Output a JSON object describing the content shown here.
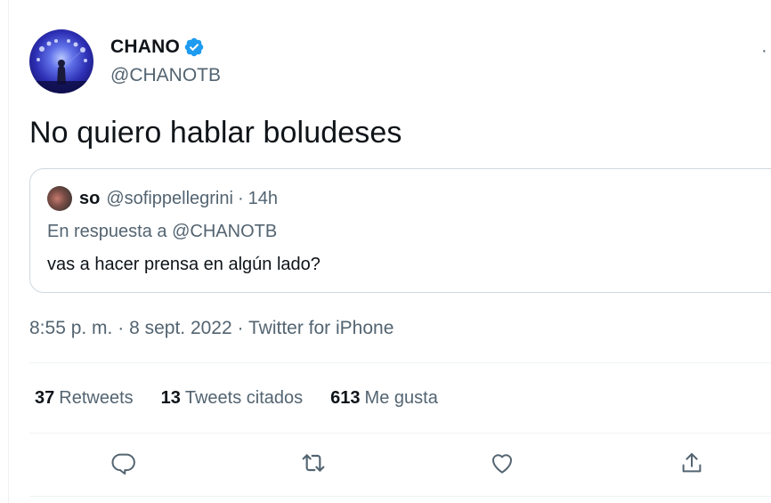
{
  "author": {
    "name": "CHANO",
    "handle": "@CHANOTB",
    "verified": true,
    "verified_color": "#1d9bf0",
    "more_label": "·"
  },
  "tweet": {
    "text": "No quiero hablar boludeses"
  },
  "quoted": {
    "name": "so",
    "handle": "@sofippellegrini",
    "separator": "·",
    "time": "14h",
    "reply_prefix": "En respuesta a",
    "reply_to": "@CHANOTB",
    "text": "vas a hacer prensa en algún lado?"
  },
  "meta": {
    "time": "8:55 p. m.",
    "separator": "·",
    "date": "8 sept. 2022",
    "source": "Twitter for iPhone"
  },
  "stats": {
    "retweets_count": "37",
    "retweets_label": "Retweets",
    "quotes_count": "13",
    "quotes_label": "Tweets citados",
    "likes_count": "613",
    "likes_label": "Me gusta"
  },
  "actions": {
    "reply_icon": "reply-icon",
    "retweet_icon": "retweet-icon",
    "like_icon": "heart-icon",
    "share_icon": "share-icon"
  },
  "colors": {
    "text_primary": "#0f1419",
    "text_secondary": "#536471",
    "border": "#cfd9de",
    "divider": "#eff3f4"
  }
}
